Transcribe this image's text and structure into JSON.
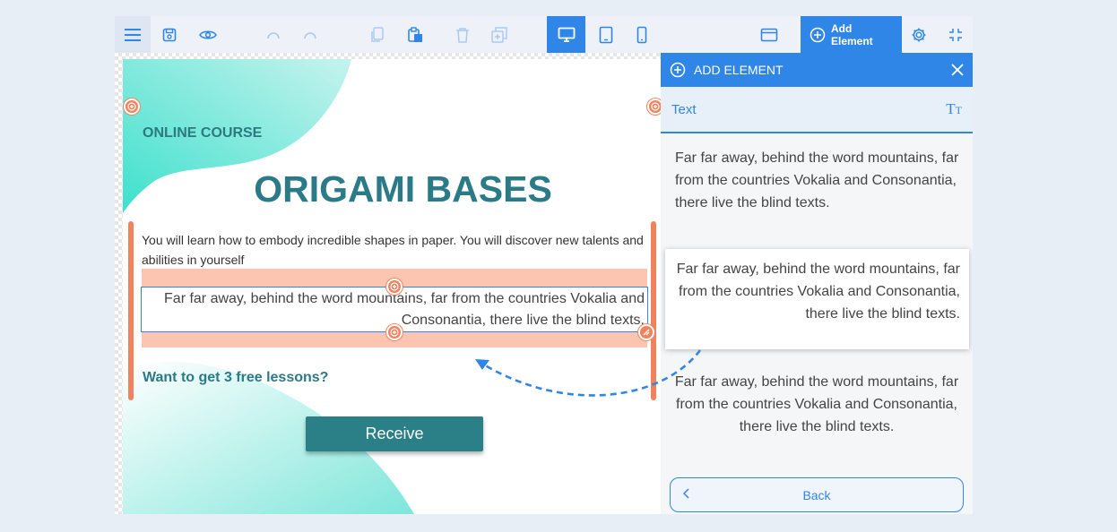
{
  "toolbar": {
    "add_element_label": "Add Element"
  },
  "page": {
    "eyebrow": "ONLINE COURSE",
    "headline": "ORIGAMI BASES",
    "intro": "You will learn how to embody incredible shapes in paper. You will discover new talents and abilities in yourself",
    "selected_text": "Far far away, behind the word mountains, far from the countries Vokalia and Consonantia, there live the blind texts.",
    "cta_label": "Want to get 3 free lessons?",
    "button_label": "Receive"
  },
  "panel": {
    "title": "ADD ELEMENT",
    "category": "Text",
    "samples": [
      "Far far away, behind the word mountains, far from the countries Vokalia and Consonantia, there live the blind texts.",
      "Far far away, behind the word mountains, far from the countries Vokalia and Consonantia, there live the blind texts.",
      "Far far away, behind the word mountains, far from the countries Vokalia and Consonantia, there live the blind texts."
    ],
    "back_label": "Back"
  },
  "colors": {
    "accent": "#2f86e6",
    "brand_teal": "#2b7a87",
    "handle_orange": "#f0835e",
    "drop_zone": "#fcc5b1"
  }
}
